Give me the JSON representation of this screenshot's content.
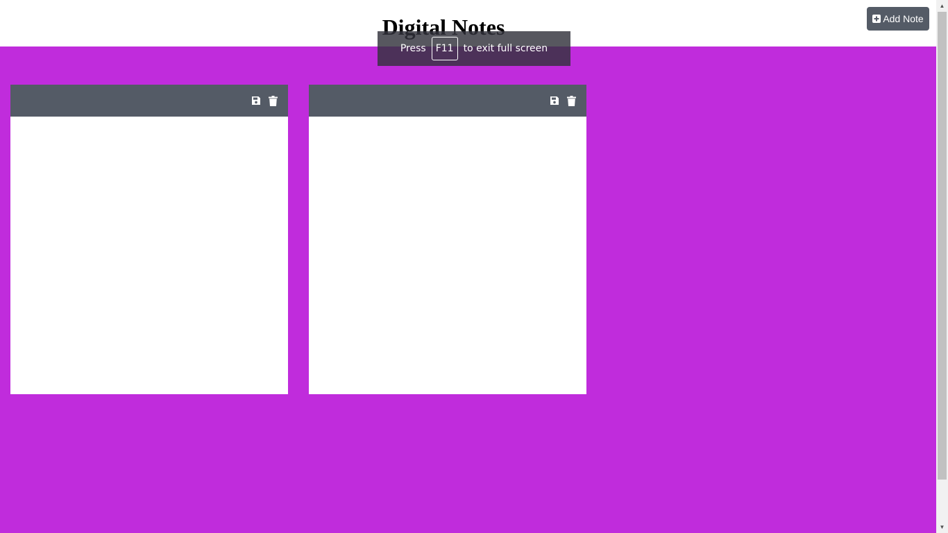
{
  "header": {
    "title": "Digital Notes",
    "add_button_label": "Add Note",
    "add_button_icon": "plus-square-icon"
  },
  "notes": [
    {
      "content": "",
      "save_icon": "save-icon",
      "delete_icon": "trash-icon"
    },
    {
      "content": "",
      "save_icon": "save-icon",
      "delete_icon": "trash-icon"
    }
  ],
  "fullscreen_notice": {
    "prefix": "Press",
    "key": "F11",
    "suffix": "to exit full screen"
  },
  "colors": {
    "background": "#c02cdc",
    "toolbar": "#545b66",
    "note": "#ffffff",
    "button": "#545b66"
  }
}
